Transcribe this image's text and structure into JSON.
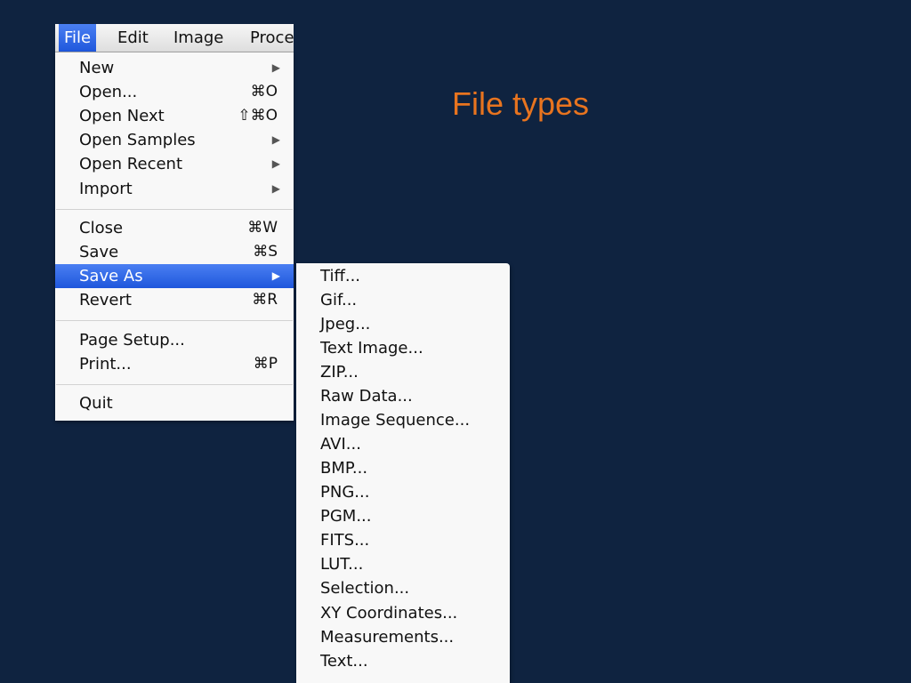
{
  "slide": {
    "title": "File types"
  },
  "colors": {
    "background": "#0f2340",
    "title": "#e8741f",
    "menu_highlight": "#2a62e6"
  },
  "menubar": {
    "items": [
      "File",
      "Edit",
      "Image",
      "Proce"
    ],
    "selected": "File"
  },
  "file_menu": {
    "items": [
      {
        "label": "New",
        "arrow": "▶"
      },
      {
        "label": "Open...",
        "shortcut": "⌘O"
      },
      {
        "label": "Open Next",
        "shortcut": "⇧⌘O"
      },
      {
        "label": "Open Samples",
        "arrow": "▶"
      },
      {
        "label": "Open Recent",
        "arrow": "▶"
      },
      {
        "label": "Import",
        "arrow": "▶"
      },
      {
        "label": "Close",
        "shortcut": "⌘W"
      },
      {
        "label": "Save",
        "shortcut": "⌘S"
      },
      {
        "label": "Save As",
        "arrow": "▶",
        "highlighted": true
      },
      {
        "label": "Revert",
        "shortcut": "⌘R"
      },
      {
        "label": "Page Setup..."
      },
      {
        "label": "Print...",
        "shortcut": "⌘P"
      },
      {
        "label": "Quit"
      }
    ]
  },
  "save_as_submenu": {
    "items": [
      "Tiff...",
      "Gif...",
      "Jpeg...",
      "Text Image...",
      "ZIP...",
      "Raw Data...",
      "Image Sequence...",
      "AVI...",
      "BMP...",
      "PNG...",
      "PGM...",
      "FITS...",
      "LUT...",
      "Selection...",
      "XY Coordinates...",
      "Measurements...",
      "Text..."
    ]
  }
}
